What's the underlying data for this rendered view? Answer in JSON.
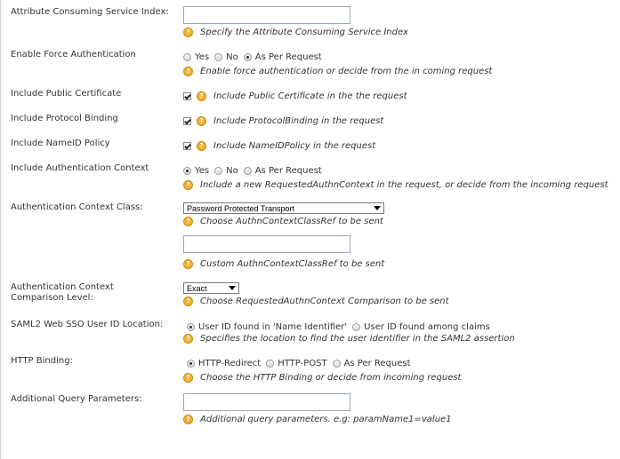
{
  "fields": {
    "acs_index": {
      "label": "Attribute Consuming Service Index:",
      "value": "",
      "hint": "Specify the Attribute Consuming Service Index"
    },
    "force_auth": {
      "label": "Enable Force Authentication",
      "options": [
        "Yes",
        "No",
        "As Per Request"
      ],
      "selected": "As Per Request",
      "hint": "Enable force authentication or decide from the in coming request"
    },
    "public_cert": {
      "label": "Include Public Certificate",
      "checked": true,
      "hint": "Include Public Certificate in the the request"
    },
    "protocol_binding": {
      "label": "Include Protocol Binding",
      "checked": true,
      "hint": "Include ProtocolBinding in the request"
    },
    "nameid_policy": {
      "label": "Include NameID Policy",
      "checked": true,
      "hint": "Include NameIDPolicy in the request"
    },
    "auth_context": {
      "label": "Include Authentication Context",
      "options": [
        "Yes",
        "No",
        "As Per Request"
      ],
      "selected": "Yes",
      "hint": "Include a new RequestedAuthnContext in the request, or decide from the incoming request"
    },
    "auth_context_class": {
      "label": "Authentication Context Class:",
      "selected": "Password Protected Transport",
      "hint": "Choose AuthnContextClassRef to be sent",
      "custom_value": "",
      "custom_hint": "Custom AuthnContextClassRef to be sent"
    },
    "comparison_level": {
      "label": "Authentication Context Comparison Level:",
      "selected": "Exact",
      "hint": "Choose RequestedAuthnContext Comparison to be sent"
    },
    "user_id_location": {
      "label": "SAML2 Web SSO User ID Location:",
      "options": [
        "User ID found in 'Name Identifier'",
        "User ID found among claims"
      ],
      "selected": "User ID found in 'Name Identifier'",
      "hint": "Specifies the location to find the user identifier in the SAML2 assertion"
    },
    "http_binding": {
      "label": "HTTP Binding:",
      "options": [
        "HTTP-Redirect",
        "HTTP-POST",
        "As Per Request"
      ],
      "selected": "HTTP-Redirect",
      "hint": "Choose the HTTP Binding or decide from incoming request"
    },
    "query_params": {
      "label": "Additional Query Parameters:",
      "value": "",
      "hint": "Additional query parameters. e.g: paramName1=value1"
    }
  },
  "icons": {
    "help": "help-icon",
    "help_glyph": "?"
  },
  "colors": {
    "help_icon": "#f0b430",
    "input_border": "#9aa6b2"
  }
}
